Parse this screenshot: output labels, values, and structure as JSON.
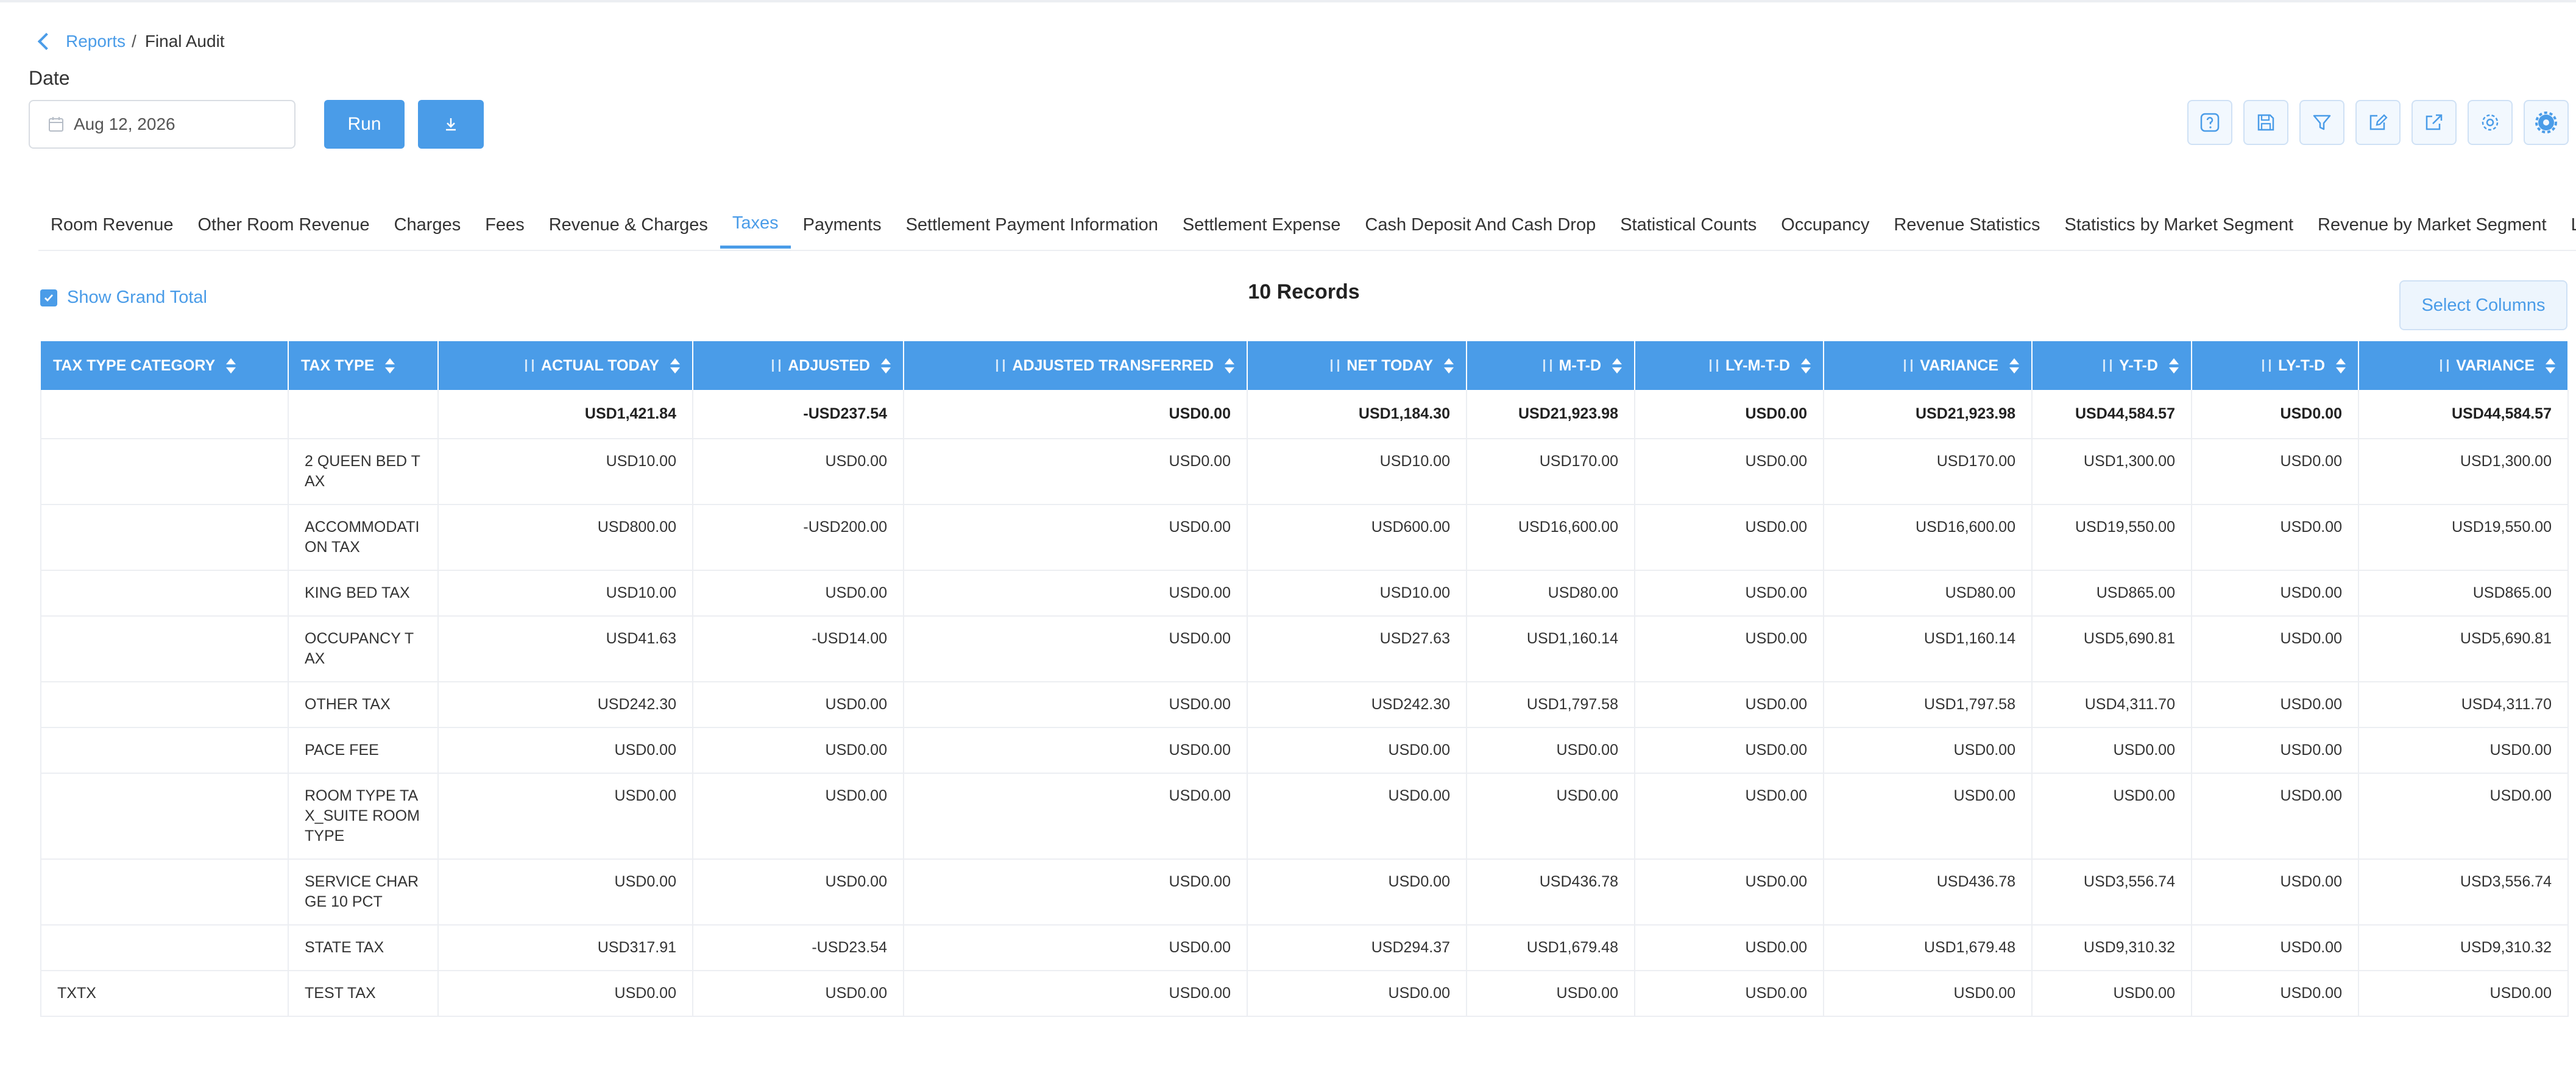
{
  "breadcrumb": {
    "parent": "Reports",
    "separator": "/",
    "current": "Final Audit"
  },
  "date": {
    "label": "Date",
    "value": "Aug 12, 2026"
  },
  "buttons": {
    "run": "Run"
  },
  "toolbar_icons": [
    "help-icon",
    "save-icon",
    "filter-icon",
    "edit-icon",
    "external-link-icon",
    "settings-icon",
    "advanced-settings-icon"
  ],
  "tabs": [
    {
      "label": "Room Revenue"
    },
    {
      "label": "Other Room Revenue"
    },
    {
      "label": "Charges"
    },
    {
      "label": "Fees"
    },
    {
      "label": "Revenue & Charges"
    },
    {
      "label": "Taxes",
      "active": true
    },
    {
      "label": "Payments"
    },
    {
      "label": "Settlement Payment Information"
    },
    {
      "label": "Settlement Expense"
    },
    {
      "label": "Cash Deposit And Cash Drop"
    },
    {
      "label": "Statistical Counts"
    },
    {
      "label": "Occupancy"
    },
    {
      "label": "Revenue Statistics"
    },
    {
      "label": "Statistics by Market Segment"
    },
    {
      "label": "Revenue by Market Segment"
    },
    {
      "label": "Local M"
    }
  ],
  "grand_total": {
    "label": "Show Grand Total",
    "checked": true
  },
  "records": "10 Records",
  "select_columns": "Select Columns",
  "colors": {
    "accent": "#4a9ce8",
    "border": "#eceef2"
  },
  "table": {
    "columns": [
      "TAX TYPE CATEGORY",
      "TAX TYPE",
      "ACTUAL TODAY",
      "ADJUSTED",
      "ADJUSTED TRANSFERRED",
      "NET TODAY",
      "M-T-D",
      "LY-M-T-D",
      "VARIANCE",
      "Y-T-D",
      "LY-T-D",
      "VARIANCE"
    ],
    "total": [
      "",
      "",
      "USD1,421.84",
      "-USD237.54",
      "USD0.00",
      "USD1,184.30",
      "USD21,923.98",
      "USD0.00",
      "USD21,923.98",
      "USD44,584.57",
      "USD0.00",
      "USD44,584.57"
    ],
    "rows": [
      [
        "",
        "2 QUEEN BED TAX",
        "USD10.00",
        "USD0.00",
        "USD0.00",
        "USD10.00",
        "USD170.00",
        "USD0.00",
        "USD170.00",
        "USD1,300.00",
        "USD0.00",
        "USD1,300.00"
      ],
      [
        "",
        "ACCOMMODATION TAX",
        "USD800.00",
        "-USD200.00",
        "USD0.00",
        "USD600.00",
        "USD16,600.00",
        "USD0.00",
        "USD16,600.00",
        "USD19,550.00",
        "USD0.00",
        "USD19,550.00"
      ],
      [
        "",
        "KING BED TAX",
        "USD10.00",
        "USD0.00",
        "USD0.00",
        "USD10.00",
        "USD80.00",
        "USD0.00",
        "USD80.00",
        "USD865.00",
        "USD0.00",
        "USD865.00"
      ],
      [
        "",
        "OCCUPANCY TAX",
        "USD41.63",
        "-USD14.00",
        "USD0.00",
        "USD27.63",
        "USD1,160.14",
        "USD0.00",
        "USD1,160.14",
        "USD5,690.81",
        "USD0.00",
        "USD5,690.81"
      ],
      [
        "",
        "OTHER TAX",
        "USD242.30",
        "USD0.00",
        "USD0.00",
        "USD242.30",
        "USD1,797.58",
        "USD0.00",
        "USD1,797.58",
        "USD4,311.70",
        "USD0.00",
        "USD4,311.70"
      ],
      [
        "",
        "PACE FEE",
        "USD0.00",
        "USD0.00",
        "USD0.00",
        "USD0.00",
        "USD0.00",
        "USD0.00",
        "USD0.00",
        "USD0.00",
        "USD0.00",
        "USD0.00"
      ],
      [
        "",
        "ROOM TYPE TAX_SUITE ROOM TYPE",
        "USD0.00",
        "USD0.00",
        "USD0.00",
        "USD0.00",
        "USD0.00",
        "USD0.00",
        "USD0.00",
        "USD0.00",
        "USD0.00",
        "USD0.00"
      ],
      [
        "",
        "SERVICE CHARGE 10 PCT",
        "USD0.00",
        "USD0.00",
        "USD0.00",
        "USD0.00",
        "USD436.78",
        "USD0.00",
        "USD436.78",
        "USD3,556.74",
        "USD0.00",
        "USD3,556.74"
      ],
      [
        "",
        "STATE TAX",
        "USD317.91",
        "-USD23.54",
        "USD0.00",
        "USD294.37",
        "USD1,679.48",
        "USD0.00",
        "USD1,679.48",
        "USD9,310.32",
        "USD0.00",
        "USD9,310.32"
      ],
      [
        "TXTX",
        "TEST TAX",
        "USD0.00",
        "USD0.00",
        "USD0.00",
        "USD0.00",
        "USD0.00",
        "USD0.00",
        "USD0.00",
        "USD0.00",
        "USD0.00",
        "USD0.00"
      ]
    ]
  }
}
